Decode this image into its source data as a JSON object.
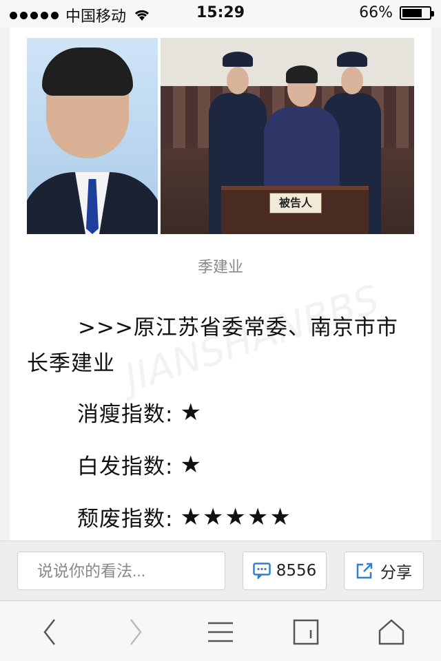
{
  "status_bar": {
    "carrier": "中国移动",
    "time": "15:29",
    "battery_percent": "66%",
    "battery_level": 0.66
  },
  "article": {
    "photo_plate_text": "被告人",
    "caption": "季建业",
    "headline": ">>>原江苏省委常委、南京市市长季建业",
    "watermark": "JIANSHANBBS",
    "ratings": [
      {
        "label": "消瘦指数:",
        "stars": "★",
        "count": 1
      },
      {
        "label": "白发指数:",
        "stars": "★",
        "count": 1
      },
      {
        "label": "颓废指数:",
        "stars": "★★★★★",
        "count": 5
      }
    ]
  },
  "comment_bar": {
    "input_placeholder": "说说你的看法...",
    "comment_count": "8556",
    "share_label": "分享"
  },
  "toolbar": {
    "icons": [
      "back-icon",
      "forward-icon",
      "menu-icon",
      "tabs-icon",
      "home-icon"
    ]
  },
  "colors": {
    "accent": "#2e7fd0",
    "caption": "#888888"
  }
}
